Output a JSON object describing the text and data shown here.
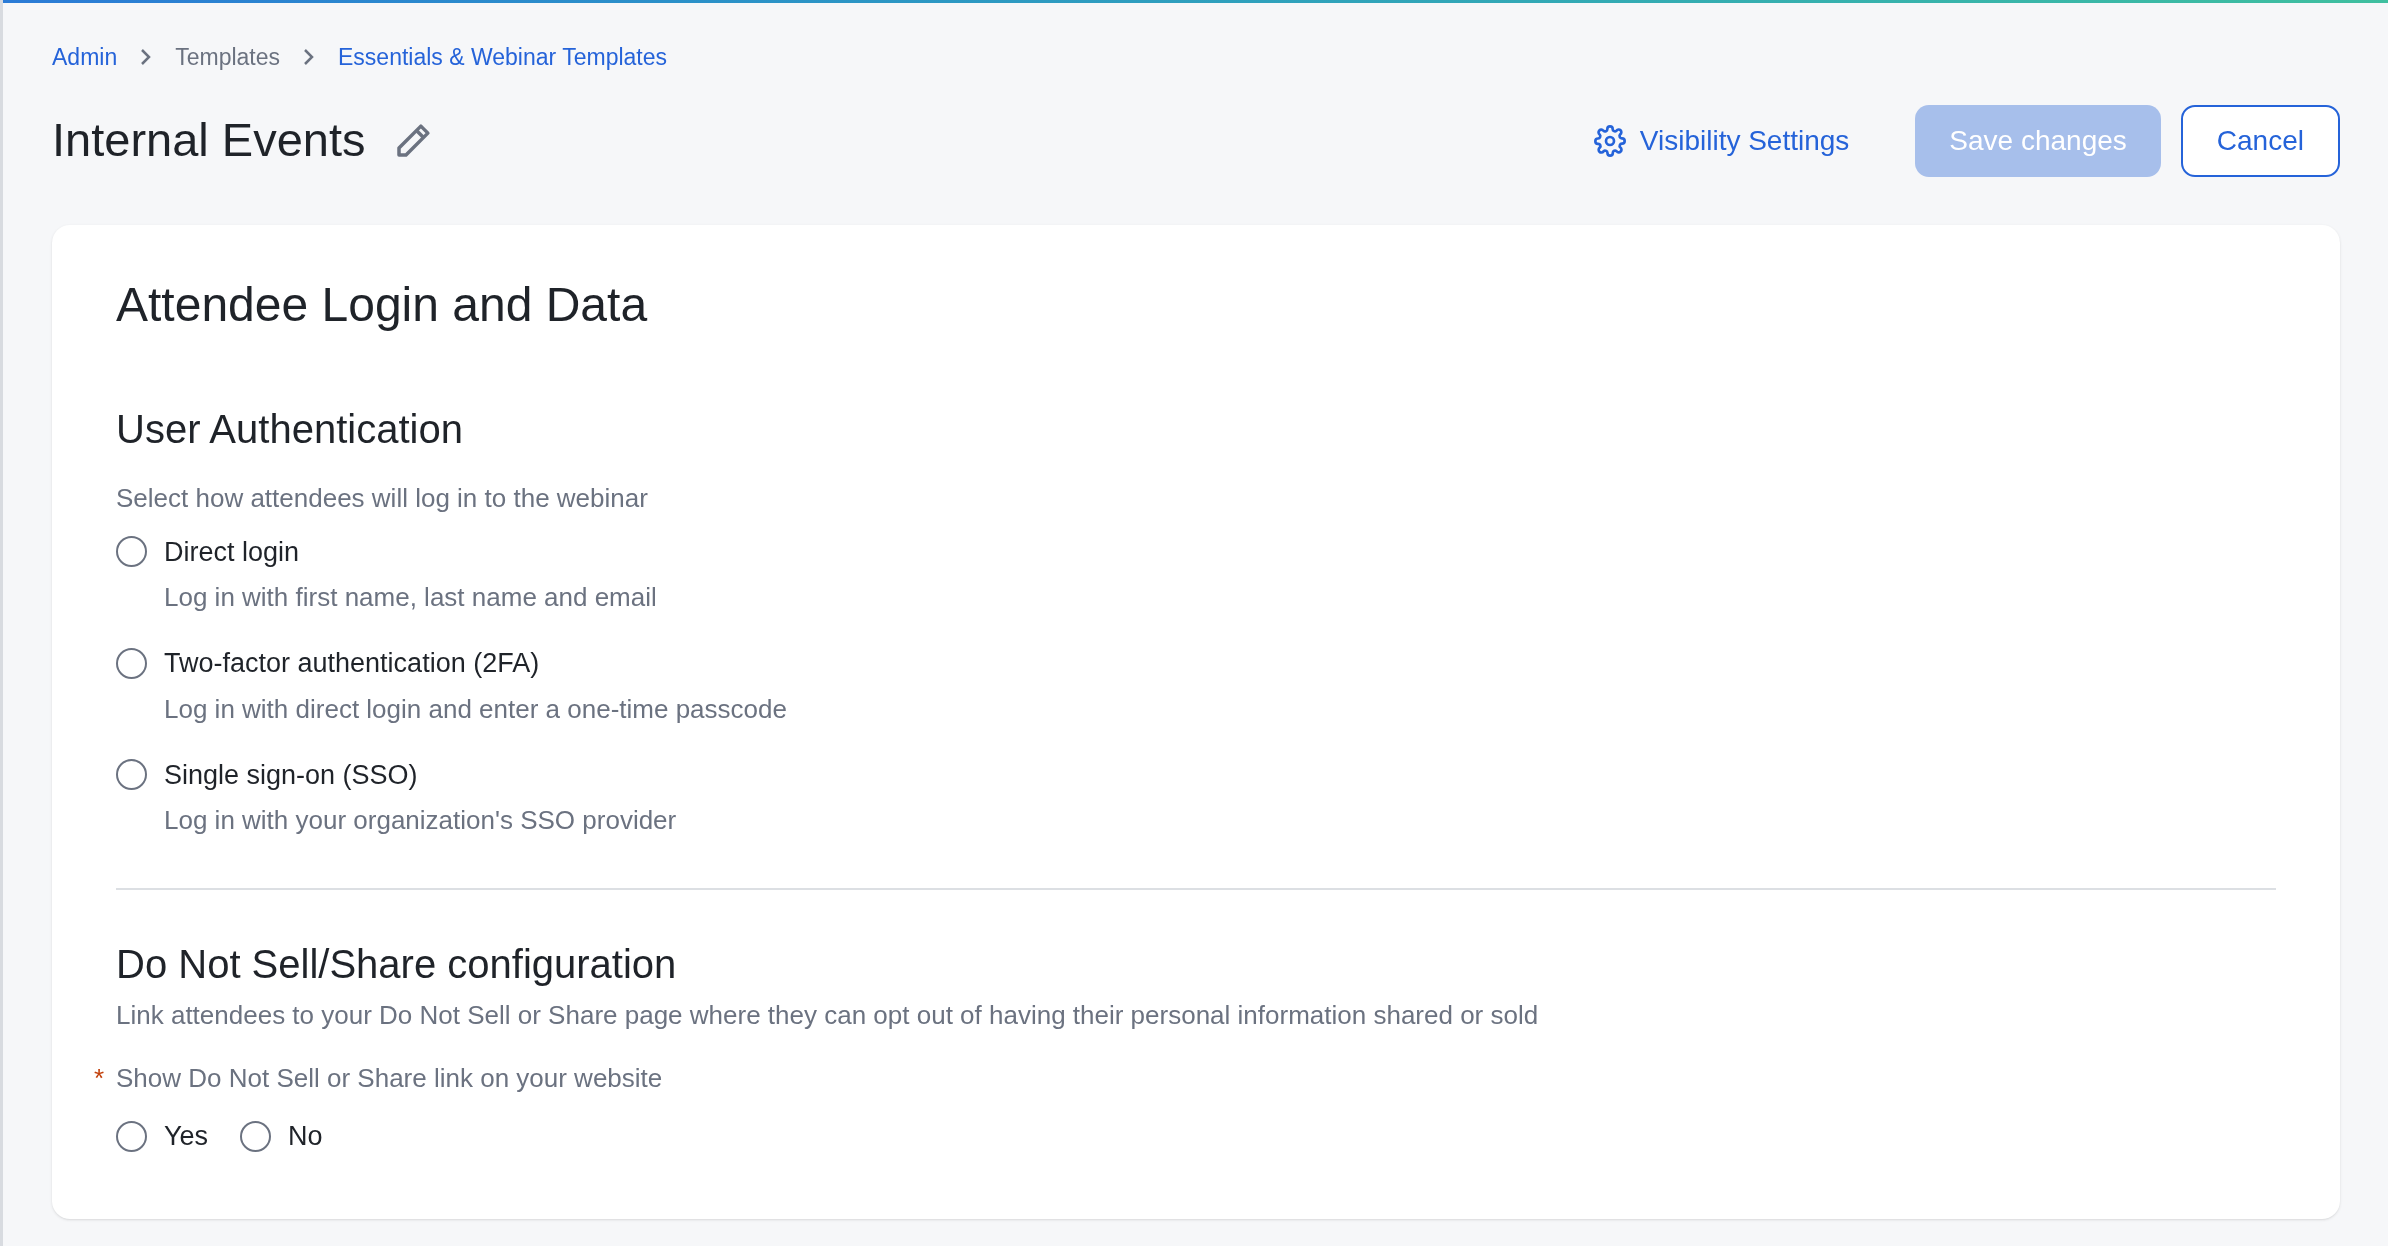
{
  "breadcrumbs": [
    {
      "label": "Admin",
      "kind": "link"
    },
    {
      "label": "Templates",
      "kind": "text"
    },
    {
      "label": "Essentials & Webinar Templates",
      "kind": "link"
    }
  ],
  "header": {
    "title": "Internal Events",
    "visibility_link": "Visibility Settings",
    "save_button": {
      "label": "Save changes",
      "disabled": true
    },
    "cancel_button": {
      "label": "Cancel"
    }
  },
  "card": {
    "title": "Attendee Login and Data",
    "authentication": {
      "title": "User Authentication",
      "description": "Select how attendees will log in to the webinar",
      "options": [
        {
          "label": "Direct login",
          "description": "Log in with first name, last name and email",
          "selected": false
        },
        {
          "label": "Two-factor authentication (2FA)",
          "description": "Log in with direct login and enter a one-time passcode",
          "selected": false
        },
        {
          "label": "Single sign-on (SSO)",
          "description": "Log in with your organization's SSO provider",
          "selected": false
        }
      ]
    },
    "do_not_sell": {
      "title": "Do Not Sell/Share configuration",
      "description": "Link attendees to your Do Not Sell or Share page where they can opt out of having their personal information shared or sold",
      "question": {
        "required_mark": "*",
        "label": "Show Do Not Sell or Share link on your website",
        "required": true
      },
      "options": [
        {
          "label": "Yes",
          "selected": false
        },
        {
          "label": "No",
          "selected": false
        }
      ]
    }
  }
}
